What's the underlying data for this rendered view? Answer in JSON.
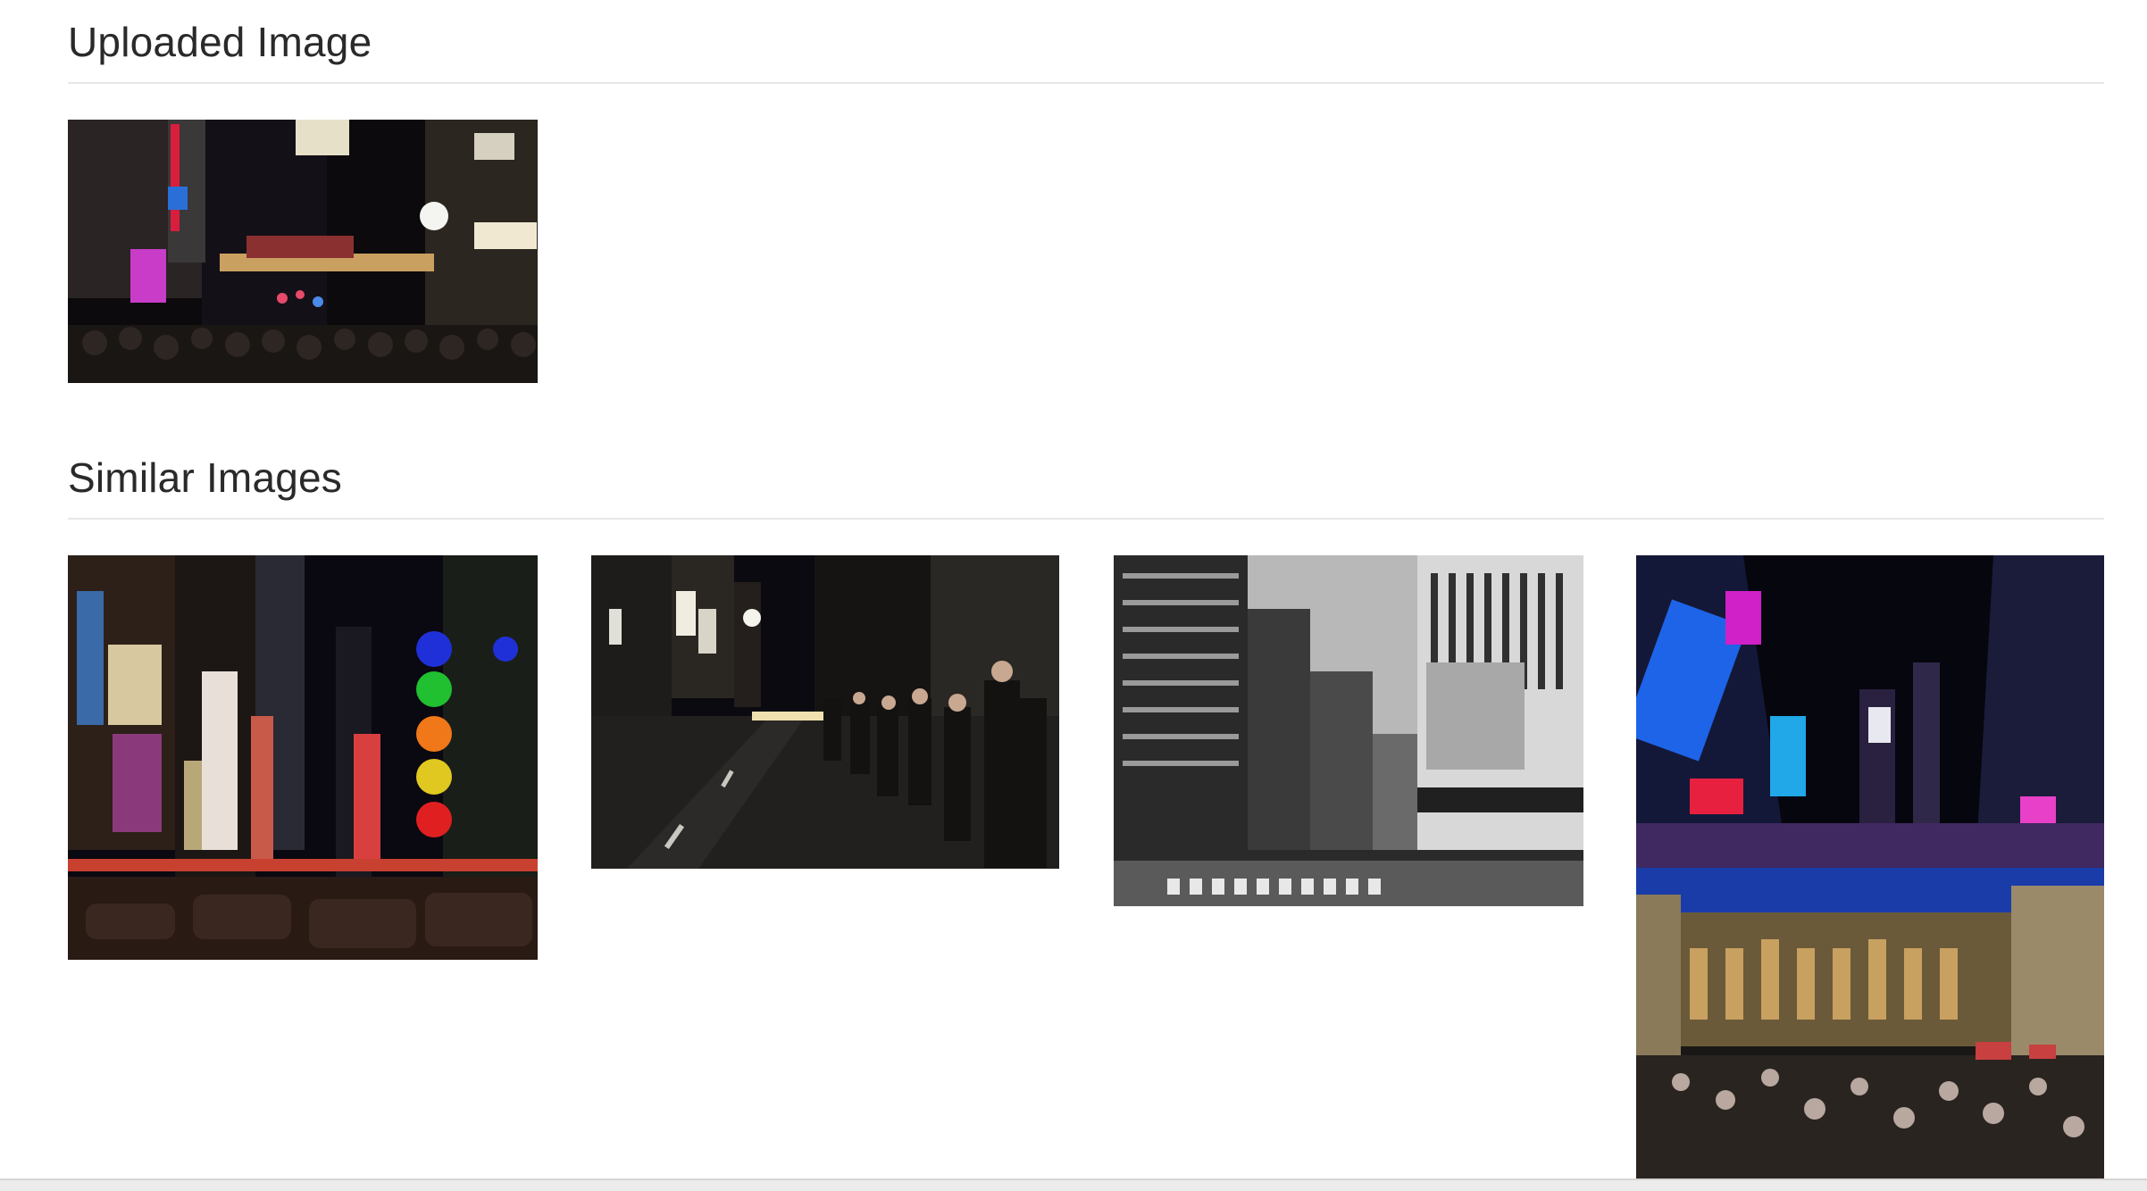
{
  "uploaded": {
    "heading": "Uploaded Image",
    "image": {
      "icon": "night-street-crowd-photo"
    }
  },
  "similar": {
    "heading": "Similar Images",
    "images": [
      {
        "icon": "times-square-night-photo"
      },
      {
        "icon": "night-street-queue-photo"
      },
      {
        "icon": "grayscale-city-intersection-photo"
      },
      {
        "icon": "times-square-and-grand-place-photo"
      }
    ]
  },
  "colors": {
    "heading": "#2a2a2a",
    "rule": "#e8e8e8",
    "background": "#ffffff"
  }
}
